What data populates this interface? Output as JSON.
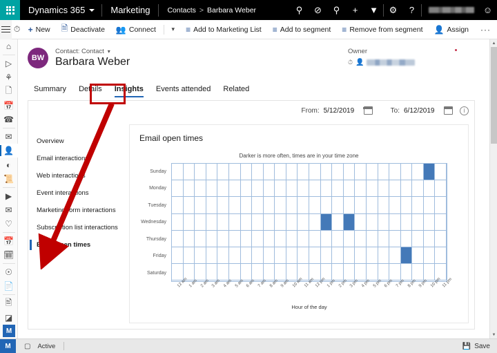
{
  "topbar": {
    "waffle": "app-launcher",
    "brand": "Dynamics 365",
    "app_name": "Marketing",
    "breadcrumb": {
      "parent": "Contacts",
      "separator": ">",
      "current": "Barbara Weber"
    },
    "icons": [
      "search-icon",
      "assistant-icon",
      "lightbulb-icon",
      "plus-icon",
      "filter-icon",
      "gear-icon",
      "help-icon"
    ],
    "user_name_redacted": true,
    "user_avatar": "person-icon"
  },
  "commandbar": {
    "menu": "site-map-toggle",
    "recent": "recent-icon",
    "new": "New",
    "deactivate": "Deactivate",
    "connect": "Connect",
    "add_to_marketing_list": "Add to Marketing List",
    "add_to_segment": "Add to segment",
    "remove_from_segment": "Remove from segment",
    "assign": "Assign",
    "overflow": "···"
  },
  "rail": {
    "items": [
      "home-icon",
      "recent-icon",
      "pinned-icon",
      "file-icon",
      "calendar-icon",
      "phone-icon",
      "activity-icon",
      "contacts-icon",
      "segments-icon",
      "customer-journey-icon",
      "marketing-email-icon",
      "mail-icon",
      "heart-icon",
      "event-icon",
      "calendar2-icon",
      "social-icon",
      "form-icon",
      "page-icon",
      "lead-icon",
      "survey-icon"
    ],
    "selected": "contacts-icon",
    "badge": "M"
  },
  "record": {
    "initials": "BW",
    "type_label": "Contact: Contact",
    "name": "Barbara Weber",
    "owner_label": "Owner",
    "owner_value_redacted": true
  },
  "tabs": [
    {
      "label": "Summary",
      "active": false
    },
    {
      "label": "Details",
      "active": false
    },
    {
      "label": "Insights",
      "active": true
    },
    {
      "label": "Events attended",
      "active": false
    },
    {
      "label": "Related",
      "active": false
    }
  ],
  "filters": {
    "from_label": "From:",
    "from_value": "5/12/2019",
    "to_label": "To:",
    "to_value": "6/12/2019",
    "info_icon": "info-icon"
  },
  "insights_nav": [
    {
      "label": "Overview",
      "selected": false
    },
    {
      "label": "Email interactions",
      "selected": false
    },
    {
      "label": "Web interactions",
      "selected": false
    },
    {
      "label": "Event interactions",
      "selected": false
    },
    {
      "label": "Marketing form interactions",
      "selected": false
    },
    {
      "label": "Subscription list interactions",
      "selected": false
    },
    {
      "label": "Email open times",
      "selected": true
    }
  ],
  "statusbar": {
    "badge": "M",
    "lock_icon": "lock-icon",
    "state": "Active",
    "save_icon": "save-icon",
    "save_label": "Save"
  },
  "annotations": {
    "highlight_box_target": "Insights",
    "arrow_from": "Insights",
    "arrow_to": "Email open times",
    "color": "#c00000"
  },
  "chart_data": {
    "type": "heatmap",
    "title": "Email open times",
    "subtitle": "Darker is more often, times are in your time zone",
    "xlabel": "Hour of the day",
    "ylabel": "",
    "categories_x": [
      "12 am",
      "1 am",
      "2 am",
      "3 am",
      "4 am",
      "5 am",
      "6 am",
      "7 am",
      "8 am",
      "9 am",
      "10 am",
      "11 am",
      "12 pm",
      "1 pm",
      "2 pm",
      "3 pm",
      "4 pm",
      "5 pm",
      "6 pm",
      "7 pm",
      "8 pm",
      "9 pm",
      "10 pm",
      "11 pm"
    ],
    "categories_y": [
      "Sunday",
      "Monday",
      "Tuesday",
      "Wednesday",
      "Thursday",
      "Friday",
      "Saturday"
    ],
    "values": [
      [
        0,
        0,
        0,
        0,
        0,
        0,
        0,
        0,
        0,
        0,
        0,
        0,
        0,
        0,
        0,
        0,
        0,
        0,
        0,
        0,
        0,
        0,
        1,
        0
      ],
      [
        0,
        0,
        0,
        0,
        0,
        0,
        0,
        0,
        0,
        0,
        0,
        0,
        0,
        0,
        0,
        0,
        0,
        0,
        0,
        0,
        0,
        0,
        0,
        0
      ],
      [
        0,
        0,
        0,
        0,
        0,
        0,
        0,
        0,
        0,
        0,
        0,
        0,
        0,
        0,
        0,
        0,
        0,
        0,
        0,
        0,
        0,
        0,
        0,
        0
      ],
      [
        0,
        0,
        0,
        0,
        0,
        0,
        0,
        0,
        0,
        0,
        0,
        0,
        0,
        1,
        0,
        1,
        0,
        0,
        0,
        0,
        0,
        0,
        0,
        0
      ],
      [
        0,
        0,
        0,
        0,
        0,
        0,
        0,
        0,
        0,
        0,
        0,
        0,
        0,
        0,
        0,
        0,
        0,
        0,
        0,
        0,
        0,
        0,
        0,
        0
      ],
      [
        0,
        0,
        0,
        0,
        0,
        0,
        0,
        0,
        0,
        0,
        0,
        0,
        0,
        0,
        0,
        0,
        0,
        0,
        0,
        0,
        1,
        0,
        0,
        0
      ],
      [
        0,
        0,
        0,
        0,
        0,
        0,
        0,
        0,
        0,
        0,
        0,
        0,
        0,
        0,
        0,
        0,
        0,
        0,
        0,
        0,
        0,
        0,
        0,
        0
      ]
    ],
    "colors": {
      "filled": "#4479b8",
      "empty": "#ffffff",
      "gridline": "#9fbcdd"
    },
    "grid": true,
    "legend": false
  }
}
